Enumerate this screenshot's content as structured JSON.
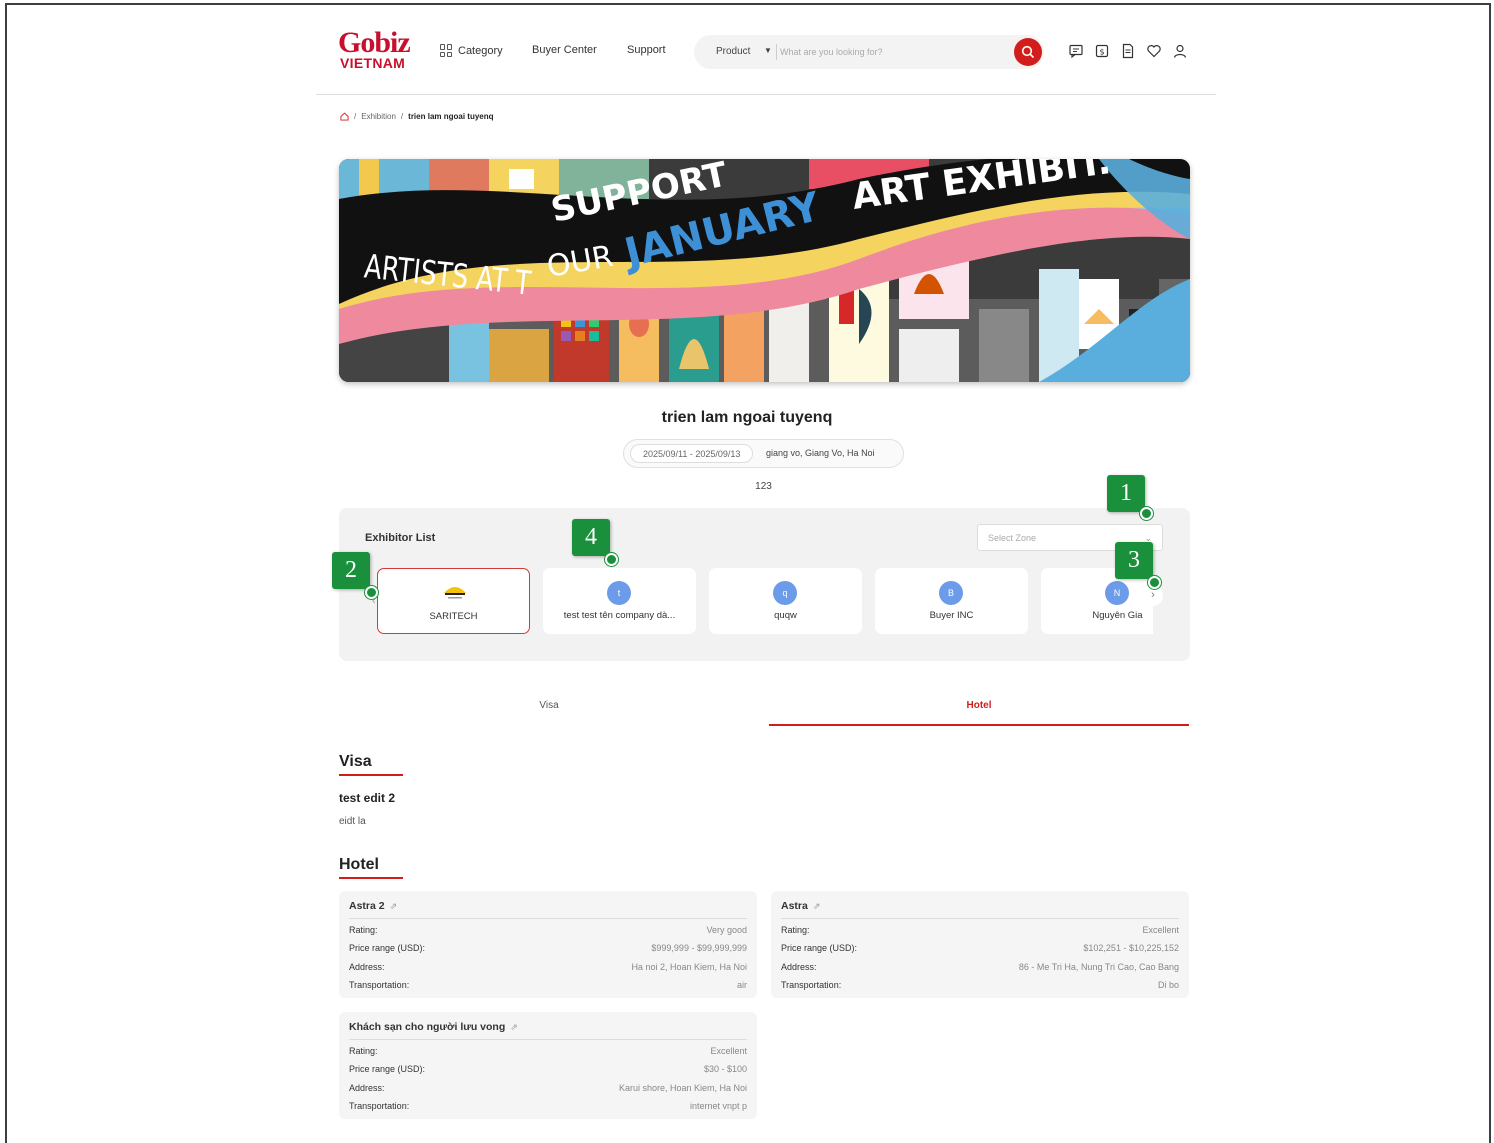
{
  "header": {
    "brand": "Gobiz",
    "brand_sub": "VIETNAM",
    "nav": {
      "category": "Category",
      "buyer_center": "Buyer Center",
      "support": "Support"
    },
    "search": {
      "category": "Product",
      "placeholder": "What are you looking for?"
    },
    "icons": [
      "chat-icon",
      "quote-icon",
      "document-icon",
      "heart-icon",
      "user-icon"
    ]
  },
  "breadcrumb": {
    "items": [
      "Exhibition"
    ],
    "current": "trien lam ngoai tuyenq"
  },
  "banner": {
    "line1": "SUPPORT",
    "line2": "ARTISTS AT T",
    "line3": "OUR",
    "line4": "JANUARY",
    "line5": "ART EXHIBIT."
  },
  "event": {
    "title": "trien lam ngoai tuyenq",
    "dates": "2025/09/11 - 2025/09/13",
    "location": "giang vo, Giang Vo, Ha Noi",
    "description": "123"
  },
  "exhibitors": {
    "label": "Exhibitor List",
    "zone_placeholder": "Select Zone",
    "items": [
      {
        "name": "SARITECH",
        "initial": "",
        "active": true
      },
      {
        "name": "test test tên company dà...",
        "initial": "t",
        "active": false
      },
      {
        "name": "quqw",
        "initial": "q",
        "active": false
      },
      {
        "name": "Buyer INC",
        "initial": "B",
        "active": false
      },
      {
        "name": "Nguyên Gia",
        "initial": "N",
        "active": false
      }
    ]
  },
  "annotations": [
    "1",
    "2",
    "3",
    "4"
  ],
  "tabs": {
    "visa": "Visa",
    "hotel": "Hotel"
  },
  "visa": {
    "heading": "Visa",
    "name": "test edit 2",
    "desc": "eidt la"
  },
  "hotel": {
    "heading": "Hotel",
    "labels": {
      "rating": "Rating:",
      "price": "Price range (USD):",
      "address": "Address:",
      "transport": "Transportation:"
    },
    "items": [
      {
        "name": "Astra 2",
        "rating": "Very good",
        "price": "$999,999 - $99,999,999",
        "address": "Ha noi 2, Hoan Kiem, Ha Noi",
        "transport": "air"
      },
      {
        "name": "Astra",
        "rating": "Excellent",
        "price": "$102,251 - $10,225,152",
        "address": "86 - Me Tri Ha, Nung Tri Cao, Cao Bang",
        "transport": "Di bo"
      },
      {
        "name": "Khách sạn cho người lưu vong",
        "rating": "Excellent",
        "price": "$30 - $100",
        "address": "Karui shore, Hoan Kiem, Ha Noi",
        "transport": "internet vnpt p"
      }
    ]
  },
  "colors": {
    "brand": "#c8102e",
    "accent": "#d21d1d",
    "annotation": "#1a8f3c",
    "avatar": "#6c9bea"
  }
}
